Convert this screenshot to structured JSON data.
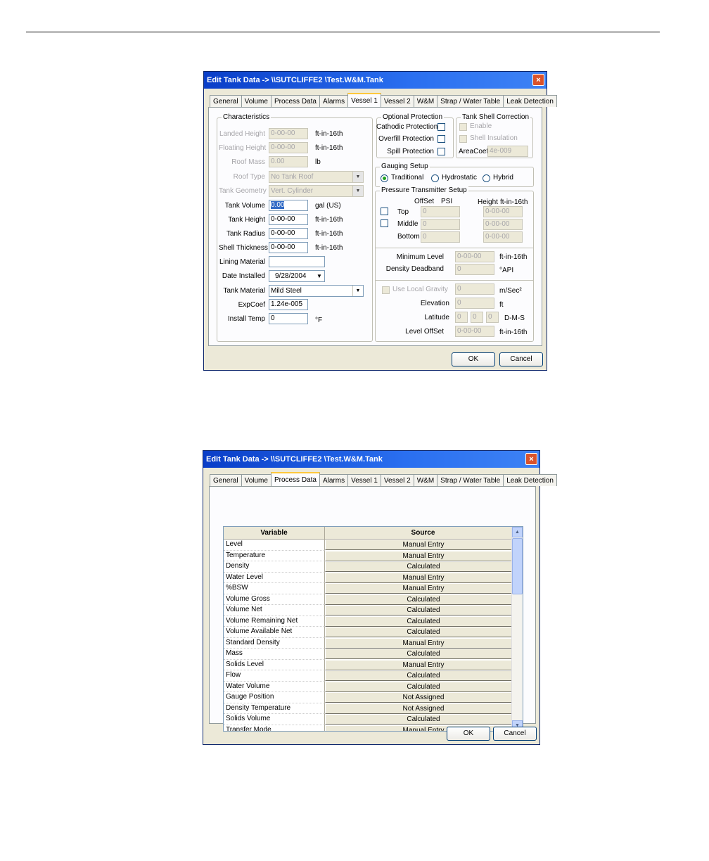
{
  "dialog1": {
    "title": "Edit Tank Data -> \\\\SUTCLIFFE2 \\Test.W&M.Tank",
    "close": "×",
    "tabs": [
      "General",
      "Volume",
      "Process Data",
      "Alarms",
      "Vessel 1",
      "Vessel 2",
      "W&M",
      "Strap / Water Table",
      "Leak Detection"
    ],
    "active_tab": "Vessel 1",
    "characteristics": {
      "title": "Characteristics",
      "landed_height": {
        "label": "Landed Height",
        "value": "0-00-00",
        "unit": "ft-in-16th"
      },
      "floating_height": {
        "label": "Floating Height",
        "value": "0-00-00",
        "unit": "ft-in-16th"
      },
      "roof_mass": {
        "label": "Roof Mass",
        "value": "0.00",
        "unit": "lb"
      },
      "roof_type": {
        "label": "Roof Type",
        "value": "No Tank Roof"
      },
      "tank_geometry": {
        "label": "Tank Geometry",
        "value": "Vert. Cylinder"
      },
      "tank_volume": {
        "label": "Tank Volume",
        "value": "0.00",
        "unit": "gal (US)"
      },
      "tank_height": {
        "label": "Tank Height",
        "value": "0-00-00",
        "unit": "ft-in-16th"
      },
      "tank_radius": {
        "label": "Tank Radius",
        "value": "0-00-00",
        "unit": "ft-in-16th"
      },
      "shell_thickness": {
        "label": "Shell Thickness",
        "value": "0-00-00",
        "unit": "ft-in-16th"
      },
      "lining_material": {
        "label": "Lining Material",
        "value": ""
      },
      "date_installed": {
        "label": "Date Installed",
        "value": "9/28/2004"
      },
      "tank_material": {
        "label": "Tank Material",
        "value": "Mild Steel"
      },
      "exp_coef": {
        "label": "ExpCoef",
        "value": "1.24e-005"
      },
      "install_temp": {
        "label": "Install Temp",
        "value": "0",
        "unit": "°F"
      }
    },
    "optional_protection": {
      "title": "Optional Protection",
      "cathodic": "Cathodic Protection",
      "overfill": "Overfill Protection",
      "spill": "Spill Protection"
    },
    "shell_correction": {
      "title": "Tank Shell Correction",
      "enable": "Enable",
      "insulation": "Shell Insulation",
      "area_coef_label": "AreaCoef",
      "area_coef_value": "4e-009"
    },
    "gauging": {
      "title": "Gauging Setup",
      "traditional": "Traditional",
      "hydrostatic": "Hydrostatic",
      "hybrid": "Hybrid"
    },
    "pressure": {
      "title": "Pressure Transmitter Setup",
      "offset_header": "OffSet",
      "psi_header": "PSI",
      "height_header": "Height",
      "height_unit": "ft-in-16th",
      "top": "Top",
      "middle": "Middle",
      "bottom": "Bottom",
      "top_offset": "0",
      "middle_offset": "0",
      "bottom_offset": "0",
      "top_height": "0-00-00",
      "middle_height": "0-00-00",
      "bottom_height": "0-00-00"
    },
    "levels": {
      "min_level_label": "Minimum Level",
      "min_level_value": "0-00-00",
      "min_level_unit": "ft-in-16th",
      "density_deadband_label": "Density Deadband",
      "density_deadband_value": "0",
      "density_deadband_unit": "°API"
    },
    "gravity": {
      "use_local": "Use Local Gravity",
      "gravity_value": "0",
      "gravity_unit": "m/Sec²",
      "elevation_label": "Elevation",
      "elevation_value": "0",
      "elevation_unit": "ft",
      "latitude_label": "Latitude",
      "lat_d": "0",
      "lat_m": "0",
      "lat_s": "0",
      "lat_unit": "D-M-S",
      "level_offset_label": "Level OffSet",
      "level_offset_value": "0-00-00",
      "level_offset_unit": "ft-in-16th"
    },
    "ok": "OK",
    "cancel": "Cancel"
  },
  "dialog2": {
    "title": "Edit Tank Data -> \\\\SUTCLIFFE2 \\Test.W&M.Tank",
    "close": "×",
    "tabs": [
      "General",
      "Volume",
      "Process Data",
      "Alarms",
      "Vessel 1",
      "Vessel 2",
      "W&M",
      "Strap / Water Table",
      "Leak Detection"
    ],
    "active_tab": "Process Data",
    "columns": [
      "Variable",
      "Source"
    ],
    "rows": [
      [
        "Level",
        "Manual Entry"
      ],
      [
        "Temperature",
        "Manual Entry"
      ],
      [
        "Density",
        "Calculated"
      ],
      [
        "Water Level",
        "Manual Entry"
      ],
      [
        "%BSW",
        "Manual Entry"
      ],
      [
        "Volume Gross",
        "Calculated"
      ],
      [
        "Volume Net",
        "Calculated"
      ],
      [
        "Volume Remaining Net",
        "Calculated"
      ],
      [
        "Volume Available Net",
        "Calculated"
      ],
      [
        "Standard Density",
        "Manual Entry"
      ],
      [
        "Mass",
        "Calculated"
      ],
      [
        "Solids Level",
        "Manual Entry"
      ],
      [
        "Flow",
        "Calculated"
      ],
      [
        "Water Volume",
        "Calculated"
      ],
      [
        "Gauge Position",
        "Not Assigned"
      ],
      [
        "Density Temperature",
        "Not Assigned"
      ],
      [
        "Solids Volume",
        "Calculated"
      ],
      [
        "Transfer Mode",
        "Manual Entry"
      ]
    ],
    "ok": "OK",
    "cancel": "Cancel"
  }
}
